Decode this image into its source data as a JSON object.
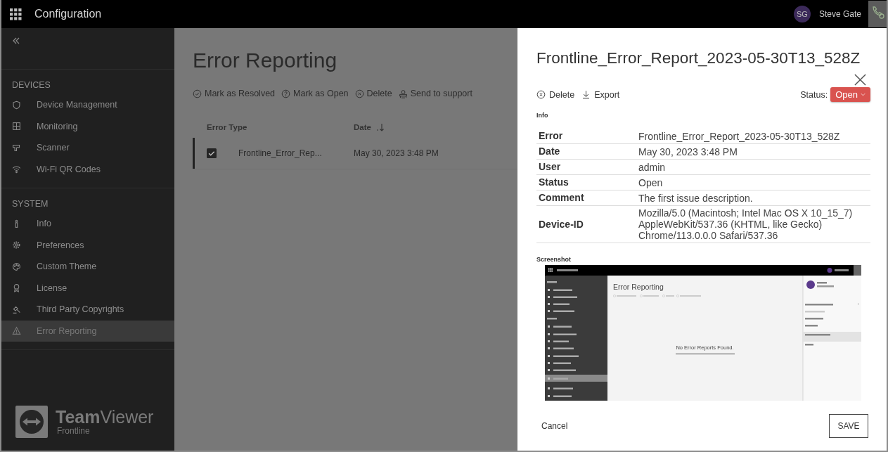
{
  "app_bar": {
    "title": "Configuration",
    "user": {
      "initials": "SG",
      "name": "Steve Gate"
    }
  },
  "sidebar": {
    "sections": [
      {
        "heading": "DEVICES",
        "items": [
          {
            "label": "Device Management",
            "selected": false
          },
          {
            "label": "Monitoring",
            "selected": false
          },
          {
            "label": "Scanner",
            "selected": false
          },
          {
            "label": "Wi-Fi QR Codes",
            "selected": false
          }
        ]
      },
      {
        "heading": "SYSTEM",
        "items": [
          {
            "label": "Info",
            "selected": false
          },
          {
            "label": "Preferences",
            "selected": false
          },
          {
            "label": "Custom Theme",
            "selected": false
          },
          {
            "label": "License",
            "selected": false
          },
          {
            "label": "Third Party Copyrights",
            "selected": false
          },
          {
            "label": "Error Reporting",
            "selected": true
          }
        ]
      }
    ],
    "logo": {
      "brand": "**Team**Viewer",
      "subtitle": "Frontline"
    }
  },
  "page": {
    "title": "Error Reporting",
    "toolbar": [
      "Mark as Resolved",
      "Mark as Open",
      "Delete",
      "Send to support"
    ]
  },
  "table": {
    "columns": [
      {
        "label": "Error Type",
        "sortable": false
      },
      {
        "label": "Date",
        "sortable": true
      }
    ],
    "rows": [
      {
        "selected": true,
        "checked": true,
        "cells": [
          "Frontline_Error_Rep...",
          "May 30, 2023 3:48 PM"
        ]
      }
    ]
  },
  "drawer": {
    "title": "Frontline_Error_Report_2023-05-30T13_528Z",
    "actions": [
      "Delete",
      "Export"
    ],
    "status_label": "Status:",
    "status_value": "Open",
    "info_heading": "Info",
    "info": [
      {
        "label": "Error",
        "lines": [
          "Frontline_Error_Report_2023-05-30T13_528Z"
        ]
      },
      {
        "label": "Date",
        "lines": [
          "May 30, 2023 3:48 PM"
        ]
      },
      {
        "label": "User",
        "lines": [
          "admin"
        ]
      },
      {
        "label": "Status",
        "lines": [
          "Open"
        ]
      },
      {
        "label": "Comment",
        "lines": [
          "The first issue description."
        ]
      },
      {
        "label": "Device-ID",
        "lines": [
          "Mozilla/5.0 (Macintosh; Intel Mac OS X 10_15_7)",
          "AppleWebKit/537.36 (KHTML, like Gecko)",
          "Chrome/113.0.0.0 Safari/537.36"
        ]
      }
    ],
    "screenshot_heading": "Screenshot",
    "screenshot": {
      "page_title": "Error Reporting",
      "empty_title": "No Error Reports Found."
    },
    "cancel": "Cancel",
    "save": "SAVE"
  }
}
